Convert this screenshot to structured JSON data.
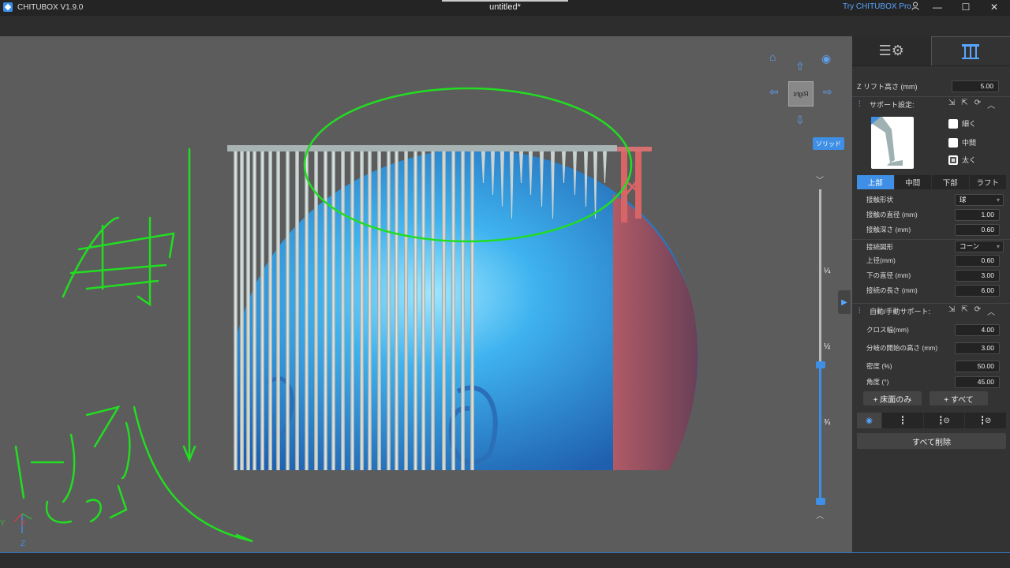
{
  "window": {
    "app_title": "CHITUBOX V1.9.0",
    "doc_title": "untitled*",
    "try_pro": "Try CHITUBOX Pro",
    "minimize": "—",
    "maximize": "☐",
    "close": "✕"
  },
  "viewport": {
    "cube_face_label": "Right",
    "render_mode_button": "ソリッド",
    "slider_ticks": [
      "¼",
      "½",
      "¾"
    ],
    "axes": {
      "y": "Y",
      "x": "X",
      "z": "Z"
    },
    "annotation": {
      "color": "#22dd22",
      "handwriting_top": "重力",
      "handwriting_bottom": "ノーサポートでよし"
    }
  },
  "panel": {
    "tabs": [
      {
        "name": "settings",
        "icon": "slice-settings-icon"
      },
      {
        "name": "supports",
        "icon": "support-pillars-icon",
        "active": true
      }
    ],
    "z_lift": {
      "label": "Z リフト高さ (mm)",
      "value": "5.00"
    },
    "support_settings": {
      "title": "サポート設定:",
      "presets": [
        {
          "label": "細く",
          "checked": false
        },
        {
          "label": "中間",
          "checked": false
        },
        {
          "label": "太く",
          "checked": true
        }
      ],
      "tabs": [
        "上部",
        "中間",
        "下部",
        "ラフト"
      ],
      "active_tab": "上部",
      "fields": [
        {
          "label": "接触形状",
          "value": "球",
          "type": "select"
        },
        {
          "label": "接触の直径 (mm)",
          "value": "1.00",
          "type": "number"
        },
        {
          "label": "接触深さ (mm)",
          "value": "0.60",
          "type": "number"
        },
        {
          "label": "接続図形",
          "value": "コーン",
          "type": "select"
        },
        {
          "label": "上径(mm)",
          "value": "0.60",
          "type": "number"
        },
        {
          "label": "下の直径 (mm)",
          "value": "3.00",
          "type": "number"
        },
        {
          "label": "接続の長さ (mm)",
          "value": "6.00",
          "type": "number"
        }
      ]
    },
    "auto_support": {
      "title": "自動/手動サポート:",
      "fields": [
        {
          "label": "クロス幅(mm)",
          "value": "4.00"
        },
        {
          "label": "分岐の開始の高さ (mm)",
          "value": "3.00"
        },
        {
          "label": "密度 (%)",
          "value": "50.00"
        },
        {
          "label": "角度 (°)",
          "value": "45.00"
        }
      ],
      "platform_only_button": "+ 床面のみ",
      "all_button": "+ すべて",
      "delete_all_button": "すべて削除"
    }
  },
  "colors": {
    "accent": "#3e8fe5",
    "model_blue": "#3f9be6",
    "support_grey": "#b8c4c2",
    "overhang_red": "#c86060"
  }
}
